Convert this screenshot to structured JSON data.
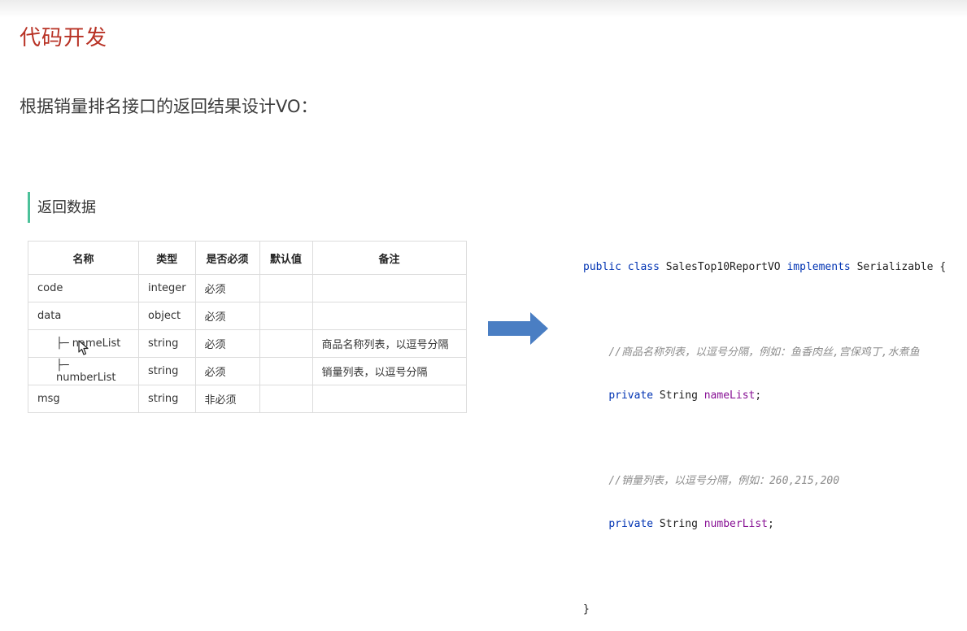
{
  "slide": {
    "title": "代码开发",
    "subtitle": "根据销量排名接口的返回结果设计VO："
  },
  "section": {
    "title": "返回数据"
  },
  "table": {
    "headers": [
      "名称",
      "类型",
      "是否必须",
      "默认值",
      "备注"
    ],
    "rows": [
      {
        "name": "code",
        "type": "integer",
        "required": "必须",
        "default": "",
        "note": ""
      },
      {
        "name": "data",
        "type": "object",
        "required": "必须",
        "default": "",
        "note": ""
      },
      {
        "name": "├─ nameList",
        "type": "string",
        "required": "必须",
        "default": "",
        "note": "商品名称列表，以逗号分隔"
      },
      {
        "name": "├─ numberList",
        "type": "string",
        "required": "必须",
        "default": "",
        "note": "销量列表，以逗号分隔"
      },
      {
        "name": "msg",
        "type": "string",
        "required": "非必须",
        "default": "",
        "note": ""
      }
    ]
  },
  "code": {
    "kw_public_class": "public class",
    "class_name": " SalesTop10ReportVO ",
    "kw_implements": "implements",
    "interface": " Serializable {",
    "comment1": "//商品名称列表，以逗号分隔，例如：鱼香肉丝,宫保鸡丁,水煮鱼",
    "kw_private1": "private",
    "type1": " String ",
    "field1": "nameList",
    "semi1": ";",
    "comment2": "//销量列表，以逗号分隔，例如：260,215,200",
    "kw_private2": "private",
    "type2": " String ",
    "field2": "numberList",
    "semi2": ";",
    "close_brace": "}"
  },
  "colors": {
    "title": "#b83225",
    "section_bar": "#4cc19a",
    "arrow": "#4a7ec3",
    "keyword": "#0033b3",
    "field": "#871094",
    "comment": "#8c8c8c"
  },
  "icons": {
    "arrow": "right-arrow-icon",
    "cursor": "mouse-cursor-icon"
  }
}
